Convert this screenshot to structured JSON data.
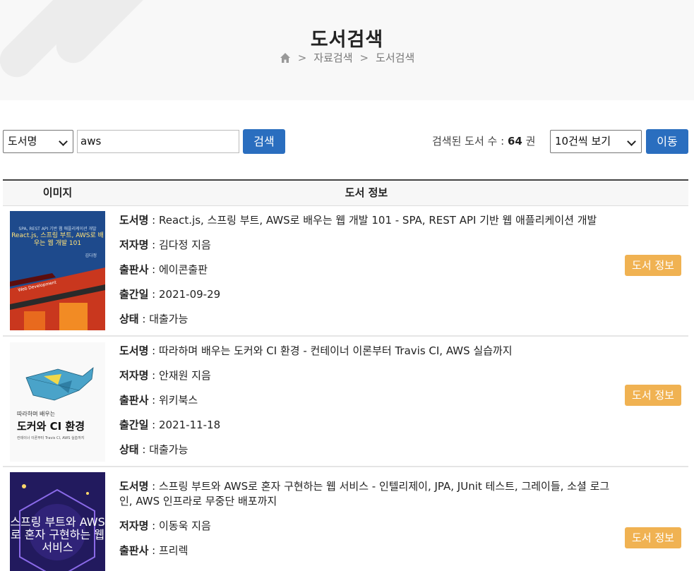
{
  "header": {
    "title": "도서검색",
    "breadcrumb": [
      "자료검색",
      "도서검색"
    ],
    "separator": ">"
  },
  "search": {
    "field_select": "도서명",
    "query": "aws",
    "search_button": "검색",
    "count_label": "검색된 도서 수 :",
    "count_value": "64",
    "count_unit": "권",
    "per_page_select": "10건씩 보기",
    "go_button": "이동"
  },
  "table": {
    "headers": [
      "이미지",
      "도서 정보"
    ]
  },
  "books": [
    {
      "fields": [
        {
          "label": "도서명",
          "value": "React.js, 스프링 부트, AWS로 배우는 웹 개발 101 - SPA, REST API 기반 웹 애플리케이션 개발"
        },
        {
          "label": "저자명",
          "value": "김다정 지음"
        },
        {
          "label": "출판사",
          "value": "에이콘출판"
        },
        {
          "label": "출간일",
          "value": "2021-09-29"
        },
        {
          "label": "상태",
          "value": "대출가능"
        }
      ],
      "button": "도서 정보",
      "cover": {
        "top_text": "SPA, REST API 기반 웹 애플리케이션 개발",
        "title": "React.js, 스프링 부트, AWS로 배우는 웹 개발 101",
        "author": "김다정",
        "ribbon": "Web Development"
      }
    },
    {
      "fields": [
        {
          "label": "도서명",
          "value": "따라하며 배우는 도커와 CI 환경 - 컨테이너 이론부터 Travis CI, AWS 실습까지"
        },
        {
          "label": "저자명",
          "value": "안재원 지음"
        },
        {
          "label": "출판사",
          "value": "위키북스"
        },
        {
          "label": "출간일",
          "value": "2021-11-18"
        },
        {
          "label": "상태",
          "value": "대출가능"
        }
      ],
      "button": "도서 정보",
      "cover": {
        "sub": "따라하며 배우는",
        "title": "도커와 CI 환경",
        "desc": "컨테이너 이론부터 Travis CI, AWS 실습까지"
      }
    },
    {
      "fields": [
        {
          "label": "도서명",
          "value": "스프링 부트와 AWS로 혼자 구현하는 웹 서비스 - 인텔리제이, JPA, JUnit 테스트, 그레이들, 소셜 로그인, AWS 인프라로 무중단 배포까지"
        },
        {
          "label": "저자명",
          "value": "이동욱 지음"
        },
        {
          "label": "출판사",
          "value": "프리렉"
        }
      ],
      "button": "도서 정보",
      "cover": {
        "title": "스프링 부트와 AWS로 혼자 구현하는 웹 서비스"
      }
    }
  ],
  "colors": {
    "primary": "#2a6ebf",
    "info_button": "#f0b252",
    "banner_bg": "#f8f8f8"
  },
  "icons": [
    "home-icon",
    "chevron-down-icon"
  ]
}
